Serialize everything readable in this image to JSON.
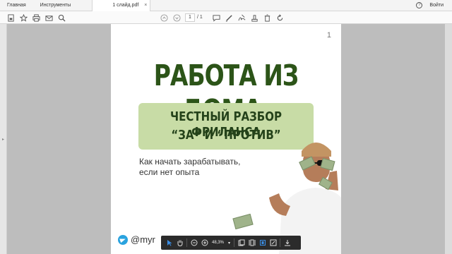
{
  "tabs": {
    "home": "Главная",
    "tools": "Инструменты",
    "file": "1 слайд.pdf",
    "close": "×"
  },
  "header": {
    "signin": "Войти",
    "help": "?"
  },
  "toolbar": {
    "page_current": "1",
    "page_total": "/ 1",
    "icons": [
      "save-icon",
      "star-icon",
      "print-icon",
      "email-icon",
      "search-icon",
      "prev-page-icon",
      "next-page-icon",
      "comment-icon",
      "pen-icon",
      "sign-icon",
      "stamp-icon",
      "delete-icon",
      "rotate-icon"
    ]
  },
  "slide": {
    "number": "1",
    "headline": "РАБОТА ИЗ ДОМА:",
    "subline1": "ЧЕСТНЫЙ РАЗБОР ФРИЛАНСА",
    "subline2": "“ЗА” И “ПРОТИВ”",
    "desc_line1": "Как начать зарабатывать,",
    "desc_line2": "если нет опыта",
    "handle": "@myr"
  },
  "float_bar": {
    "zoom": "48,3%",
    "zoom_caret": "▾"
  },
  "colors": {
    "headline": "#2c5418",
    "green_box": "#c8dca6",
    "telegram": "#2aa3df",
    "float_bar": "#2b2b2b",
    "select_accent": "#3a8ee6"
  }
}
